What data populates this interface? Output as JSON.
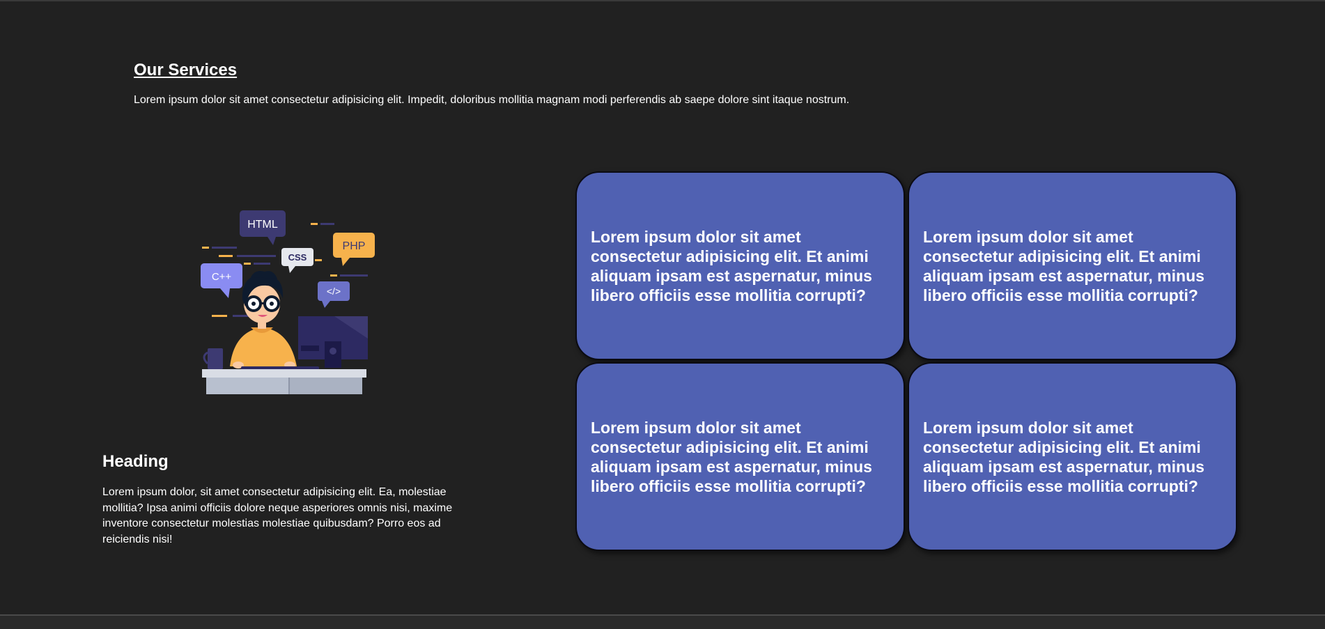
{
  "services": {
    "title": "Our Services",
    "description": "Lorem ipsum dolor sit amet consectetur adipisicing elit. Impedit, doloribus mollitia magnam modi perferendis ab saepe dolore sint itaque nostrum."
  },
  "illustration": {
    "bubble_html": "HTML",
    "bubble_css": "CSS",
    "bubble_php": "PHP",
    "bubble_cpp": "C++",
    "bubble_code": "</>",
    "colors": {
      "bubble_dark": "#3d3a72",
      "bubble_light": "#e6e8ee",
      "bubble_orange": "#f7b24c",
      "bubble_violet": "#8a8cf2",
      "bubble_blue": "#6c72c8",
      "skin": "#f9c9a2",
      "shirt": "#f7b24c",
      "hair": "#0e1b2e",
      "monitor": "#2d2a62",
      "desk": "#d9dde5"
    }
  },
  "left": {
    "heading": "Heading",
    "paragraph": "Lorem ipsum dolor, sit amet consectetur adipisicing elit. Ea, molestiae mollitia? Ipsa animi officiis dolore neque asperiores omnis nisi, maxime inventore consectetur molestias molestiae quibusdam? Porro eos ad reiciendis nisi!"
  },
  "cards": [
    {
      "text": "Lorem ipsum dolor sit amet consectetur adipisicing elit. Et animi aliquam ipsam est aspernatur, minus libero officiis esse mollitia corrupti?"
    },
    {
      "text": "Lorem ipsum dolor sit amet consectetur adipisicing elit. Et animi aliquam ipsam est aspernatur, minus libero officiis esse mollitia corrupti?"
    },
    {
      "text": "Lorem ipsum dolor sit amet consectetur adipisicing elit. Et animi aliquam ipsam est aspernatur, minus libero officiis esse mollitia corrupti?"
    },
    {
      "text": "Lorem ipsum dolor sit amet consectetur adipisicing elit. Et animi aliquam ipsam est aspernatur, minus libero officiis esse mollitia corrupti?"
    }
  ],
  "theme": {
    "background": "#212121",
    "card": "#5061b2",
    "text": "#ffffff"
  }
}
